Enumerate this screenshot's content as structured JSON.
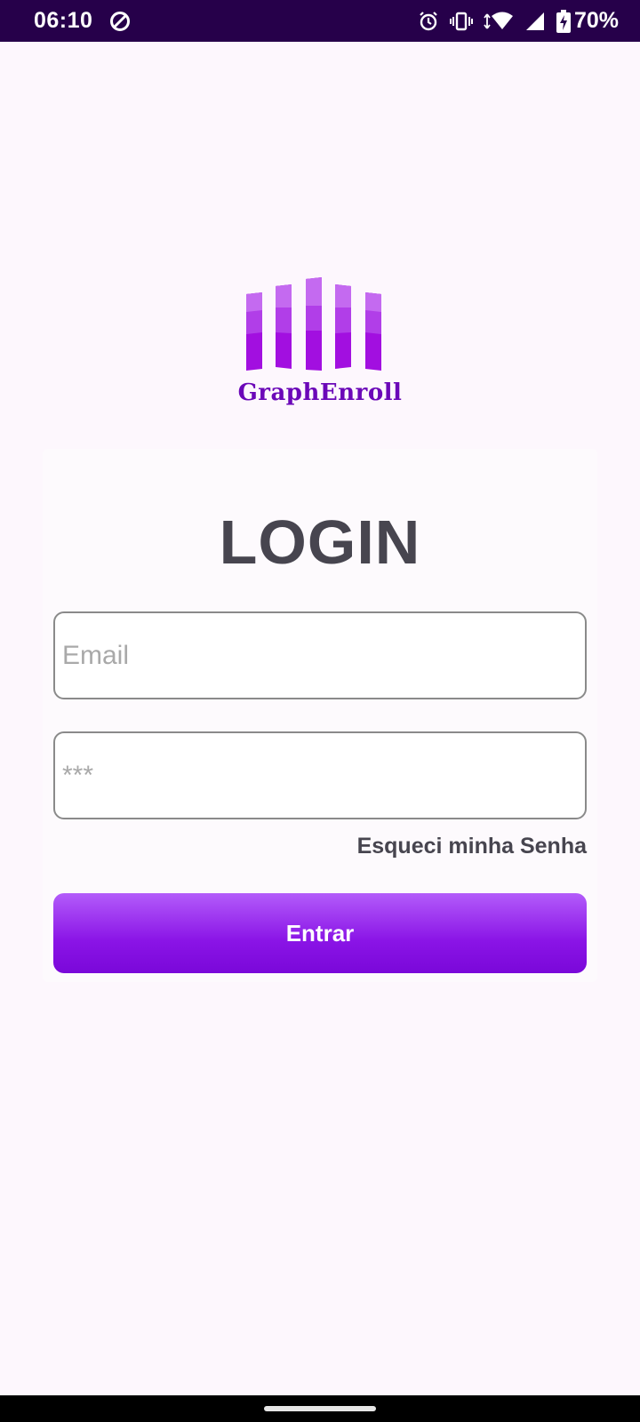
{
  "status_bar": {
    "time": "06:10",
    "battery_percent": "70%",
    "icons": [
      "data-saver-icon",
      "alarm-icon",
      "vibrate-icon",
      "wifi-icon",
      "cell-signal-icon",
      "battery-charging-icon"
    ]
  },
  "logo": {
    "text": "GraphEnroll",
    "colors": {
      "light": "#c46af0",
      "mid": "#b13ee8",
      "dark": "#a20fe0",
      "text": "#6b08b8"
    }
  },
  "login": {
    "title": "LOGIN",
    "email_placeholder": "Email",
    "email_value": "",
    "password_placeholder": "***",
    "password_value": "",
    "forgot_password": "Esqueci minha Senha",
    "submit_label": "Entrar"
  },
  "theme": {
    "accent": "#8a14e6",
    "status_bar_bg": "#26004a",
    "background": "#fdf7fd"
  }
}
